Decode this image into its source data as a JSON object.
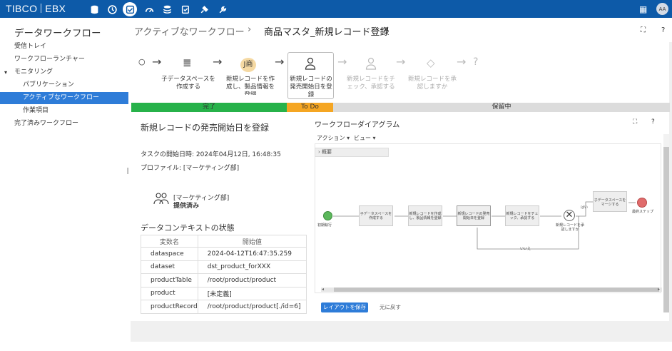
{
  "app": {
    "logo_left": "TIBCO",
    "logo_right": "EBX",
    "avatar": "AA"
  },
  "topnav": {
    "icons": [
      "database-icon",
      "clock-icon",
      "workflow-check-icon",
      "gauge-icon",
      "layers-icon",
      "edit-check-icon",
      "plug-icon",
      "wrench-icon"
    ],
    "active_index": 2
  },
  "sidebar": {
    "title": "データワークフロー",
    "items": [
      {
        "label": "受信トレイ"
      },
      {
        "label": "ワークフローランチャー"
      },
      {
        "label": "モニタリング"
      },
      {
        "label": "パブリケーション"
      },
      {
        "label": "アクティブなワークフロー"
      },
      {
        "label": "作業項目"
      },
      {
        "label": "完了済みワークフロー"
      }
    ],
    "expand_glyph": "▾"
  },
  "header": {
    "breadcrumb": "アクティブなワークフロー",
    "separator": "›",
    "title": "商品マスタ_新規レコード登録",
    "close": "×",
    "expand": "⛶",
    "help": "?"
  },
  "steps": [
    {
      "label": "",
      "icon": "○"
    },
    {
      "label": "子データスペースを作成する",
      "icon": "≣"
    },
    {
      "label": "新規レコードを作成し、製品情報を登録",
      "icon": "J商"
    },
    {
      "label": "新規レコードの発売開始日を登録",
      "icon": "👤"
    },
    {
      "label": "新規レコードをチェック、承認する",
      "icon": "👤"
    },
    {
      "label": "新規レコードを承認しますか",
      "icon": "◇"
    },
    {
      "label": "",
      "icon": "?"
    }
  ],
  "status": {
    "done": "完了",
    "todo": "To Do",
    "pending": "保留中",
    "colors": {
      "done": "#27b24a",
      "todo": "#f5a623",
      "pending": "#dcdcdc"
    }
  },
  "task": {
    "title": "新規レコードの発売開始日を登録",
    "start_label": "タスクの開始日時: 2024年04月12日, 16:48:35",
    "profile_label": "プロファイル: [マーケティング部]",
    "group": "[マーケティング部]",
    "group_status": "提供済み"
  },
  "context": {
    "title": "データコンテキストの状態",
    "headers": [
      "変数名",
      "開始値"
    ],
    "rows": [
      [
        "dataspace",
        "2024-04-12T16:47:35.259"
      ],
      [
        "dataset",
        "dst_product_forXXX"
      ],
      [
        "productTable",
        "/root/product/product"
      ],
      [
        "product",
        "[未定義]"
      ],
      [
        "productRecord",
        "/root/product/product[./id=6]"
      ]
    ]
  },
  "diagram": {
    "title": "ワークフローダイアグラム",
    "menu_action": "アクション ▾",
    "menu_view": "ビュー ▾",
    "overview": "概要",
    "start_label": "初期執行",
    "nodes": [
      "子データスペースを作成する",
      "新規レコードを作成し、製品情報を登録",
      "新規レコードの発売開始日を登録",
      "新規レコードをチェック、承認する",
      "子データスペースをマージする"
    ],
    "decision_label": "新規レコードを承認しますか",
    "yes_label": "はい",
    "no_label": "いいえ",
    "end_label": "最終ステップ",
    "save_button": "レイアウトを保存",
    "reset_button": "元に戻す"
  }
}
